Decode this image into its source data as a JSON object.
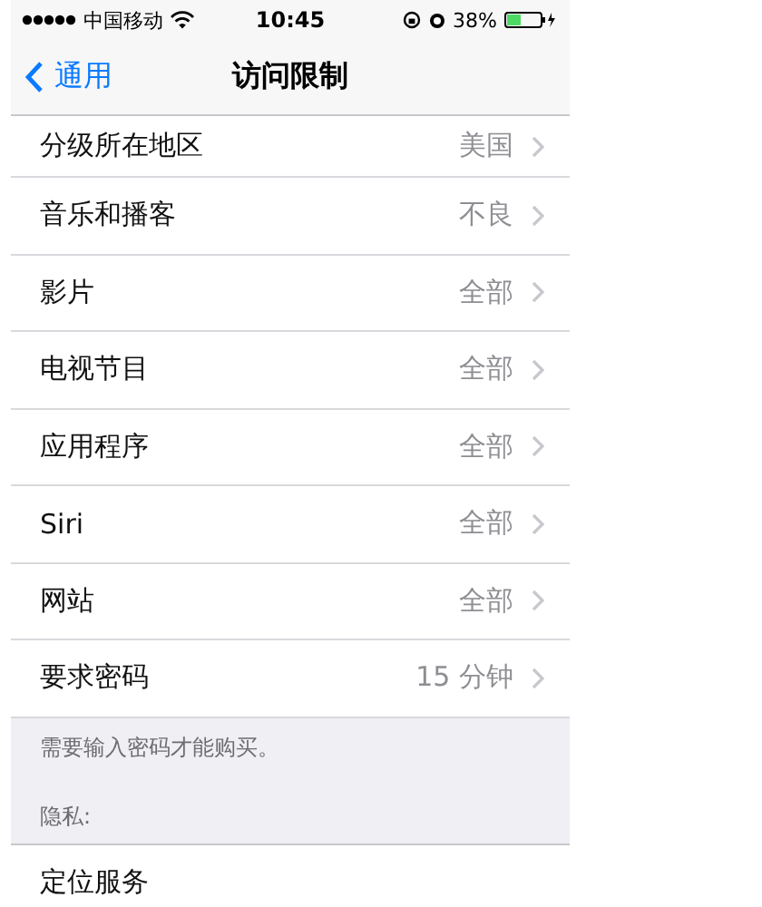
{
  "status_bar": {
    "carrier": "中国移动",
    "time": "10:45",
    "battery": "38%"
  },
  "nav_bar": {
    "back": "通用",
    "title": "访问限制"
  },
  "rows": [
    {
      "label": "分级所在地区",
      "value": "美国"
    },
    {
      "label": "音乐和播客",
      "value": "不良"
    },
    {
      "label": "影片",
      "value": "全部"
    },
    {
      "label": "电视节目",
      "value": "全部"
    },
    {
      "label": "应用程序",
      "value": "全部"
    },
    {
      "label": "Siri",
      "value": "全部"
    },
    {
      "label": "网站",
      "value": "全部"
    },
    {
      "label": "要求密码",
      "value": "15 分钟"
    }
  ],
  "footer": "需要输入密码才能购买。",
  "section_header": "隐私:",
  "rows_2": [
    {
      "label": "定位服务"
    }
  ]
}
